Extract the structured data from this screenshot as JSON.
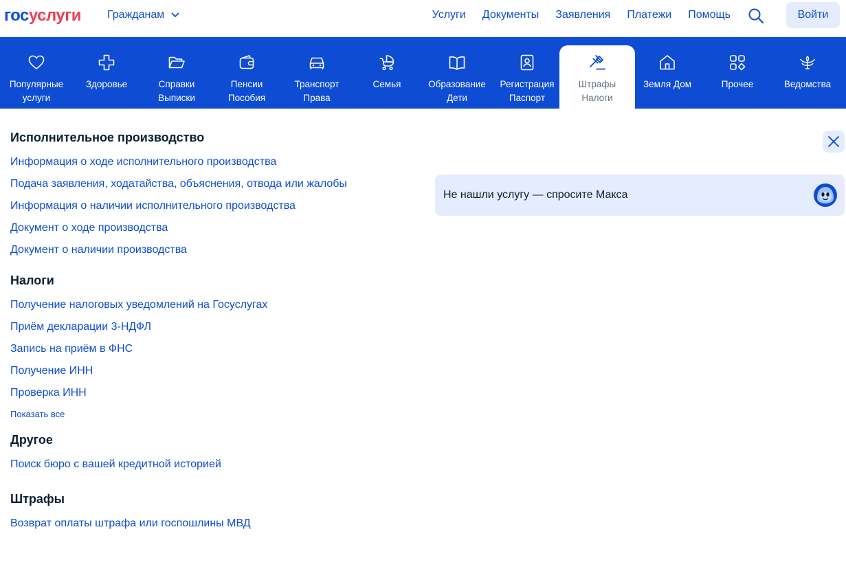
{
  "header": {
    "logo_part1": "гос",
    "logo_part2": "услуги",
    "audience": "Гражданам",
    "nav": [
      "Услуги",
      "Документы",
      "Заявления",
      "Платежи",
      "Помощь"
    ],
    "login": "Войти"
  },
  "categories": [
    {
      "label": "Популярные\nуслуги",
      "icon": "heart-icon"
    },
    {
      "label": "Здоровье",
      "icon": "medical-cross-icon"
    },
    {
      "label": "Справки\nВыписки",
      "icon": "folder-icon"
    },
    {
      "label": "Пенсии\nПособия",
      "icon": "wallet-icon"
    },
    {
      "label": "Транспорт\nПрава",
      "icon": "car-icon"
    },
    {
      "label": "Семья",
      "icon": "stroller-icon"
    },
    {
      "label": "Образование\nДети",
      "icon": "book-icon"
    },
    {
      "label": "Регистрация\nПаспорт",
      "icon": "passport-icon"
    },
    {
      "label": "Штрафы\nНалоги",
      "icon": "gavel-icon",
      "active": true
    },
    {
      "label": "Земля Дом",
      "icon": "house-icon"
    },
    {
      "label": "Прочее",
      "icon": "grid-icon"
    },
    {
      "label": "Ведомства",
      "icon": "emblem-icon"
    }
  ],
  "sections": [
    {
      "title": "Исполнительное производство",
      "links": [
        "Информация о ходе исполнительного производства",
        "Подача заявления, ходатайства, объяснения, отвода или жалобы",
        "Информация о наличии исполнительного производства",
        "Документ о ходе производства",
        "Документ о наличии производства"
      ]
    },
    {
      "title": "Налоги",
      "links": [
        "Получение налоговых уведомлений на Госуслугах",
        "Приём декларации 3-НДФЛ",
        "Запись на приём в ФНС",
        "Получение ИНН",
        "Проверка ИНН"
      ],
      "show_all": "Показать все"
    },
    {
      "title": "Другое",
      "links": [
        "Поиск бюро с вашей кредитной историей"
      ]
    },
    {
      "title": "Штрафы",
      "links": [
        "Возврат оплаты штрафа или госпошлины МВД"
      ]
    }
  ],
  "banner": {
    "text": "Не нашли услугу — спросите Макса"
  },
  "colors": {
    "brand_blue": "#0d4cd3",
    "brand_red": "#ee3f58",
    "light_blue": "#e4ecfd"
  }
}
